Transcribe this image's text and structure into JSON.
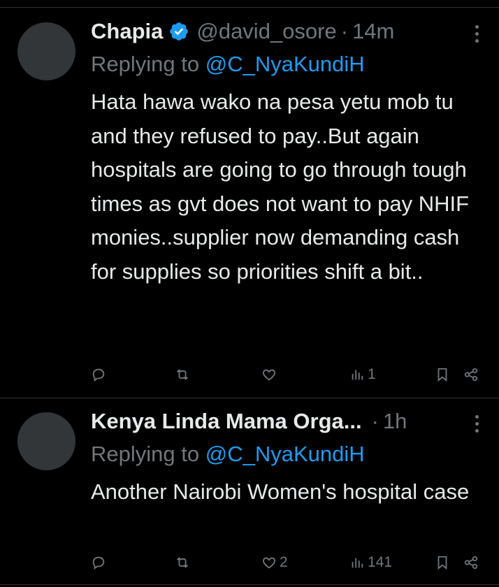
{
  "tweets": [
    {
      "name": "Chapia",
      "verified": true,
      "handle": "@david_osore",
      "separator": "·",
      "time": "14m",
      "replying_label": "Replying to ",
      "replying_to": "@C_NyaKundiH",
      "text": "Hata hawa wako na pesa yetu mob tu and they refused to pay..But again hospitals are going to go through tough times as gvt does not want to pay NHIF monies..supplier now demanding cash for supplies so priorities shift a bit..",
      "reply_count": "",
      "retweet_count": "",
      "like_count": "",
      "view_count": "1"
    },
    {
      "name": "Kenya Linda Mama Orga...",
      "verified": false,
      "handle": "",
      "separator": "·",
      "time": "1h",
      "replying_label": "Replying to ",
      "replying_to": "@C_NyaKundiH",
      "text": "Another Nairobi Women's hospital case",
      "reply_count": "",
      "retweet_count": "",
      "like_count": "2",
      "view_count": "141"
    }
  ],
  "colors": {
    "background": "#000000",
    "primary_text": "#e7e9ea",
    "secondary_text": "#71767b",
    "accent": "#1d9bf0",
    "divider": "#2f3336"
  },
  "icons": [
    "more-icon",
    "verified-badge-icon",
    "reply-icon",
    "retweet-icon",
    "like-icon",
    "views-icon",
    "bookmark-icon",
    "share-icon"
  ]
}
